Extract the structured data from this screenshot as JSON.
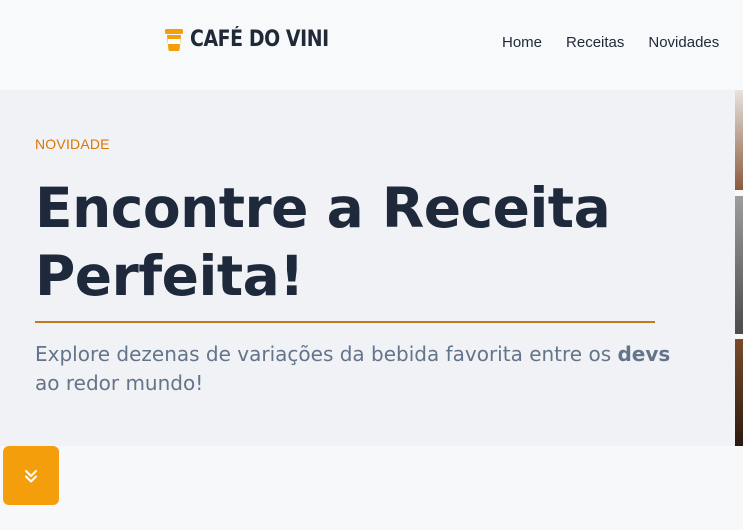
{
  "header": {
    "logo_text": "CAFÉ DO VINI",
    "nav": [
      "Home",
      "Receitas",
      "Novidades"
    ]
  },
  "hero": {
    "eyebrow": "NOVIDADE",
    "title_line1": "Encontre a Receita",
    "title_line2": "Perfeita!",
    "desc_part1": "Explore dezenas de variações da bebida favorita entre os ",
    "desc_bold": "devs",
    "desc_part2": " ao redor mundo!"
  },
  "scroll_button": {
    "icon": "double-chevron-down-icon"
  },
  "colors": {
    "accent": "#f59e0b",
    "eyebrow": "#d97706",
    "title": "#1e293b",
    "body": "#64748b"
  }
}
